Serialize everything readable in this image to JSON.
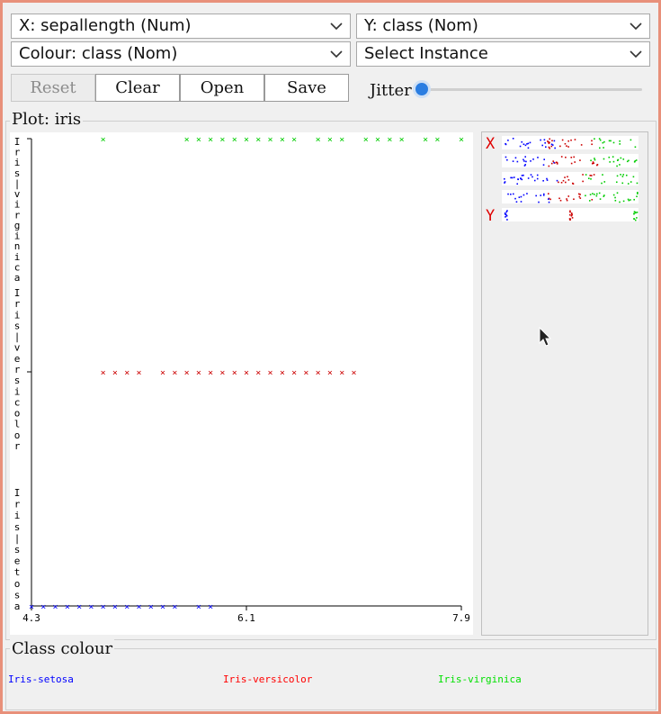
{
  "controls": {
    "x_axis": "X: sepallength (Num)",
    "y_axis": "Y: class (Nom)",
    "colour": "Colour: class (Nom)",
    "instance": "Select Instance"
  },
  "buttons": {
    "reset": "Reset",
    "clear": "Clear",
    "open": "Open",
    "save": "Save"
  },
  "jitter": {
    "label": "Jitter",
    "value": 0
  },
  "plot": {
    "title": "Plot: iris",
    "x_ticks": [
      "4.3",
      "6.1",
      "7.9"
    ],
    "y_labels": [
      "Iris-virginica",
      "Iris-versicolor",
      "Iris-setosa"
    ]
  },
  "matrix": {
    "x_marker": "X",
    "y_marker": "Y"
  },
  "class_colour": {
    "title": "Class colour",
    "items": [
      {
        "name": "Iris-setosa",
        "color": "#0000ff"
      },
      {
        "name": "Iris-versicolor",
        "color": "#ff0000"
      },
      {
        "name": "Iris-virginica",
        "color": "#00ff00"
      }
    ]
  },
  "colors": {
    "setosa": "#0000ff",
    "versicolor": "#cc0000",
    "virginica": "#00cc00",
    "border": "#e8907a"
  },
  "chart_data": {
    "type": "scatter",
    "xlabel": "sepallength",
    "ylabel": "class",
    "xlim": [
      4.3,
      7.9
    ],
    "categories": [
      "Iris-setosa",
      "Iris-versicolor",
      "Iris-virginica"
    ],
    "series": [
      {
        "name": "Iris-setosa",
        "category": "Iris-setosa",
        "x": [
          4.3,
          4.4,
          4.5,
          4.6,
          4.7,
          4.8,
          4.9,
          5.0,
          5.1,
          5.2,
          5.3,
          5.4,
          5.5,
          5.7,
          5.8
        ]
      },
      {
        "name": "Iris-versicolor",
        "category": "Iris-versicolor",
        "x": [
          4.9,
          5.0,
          5.1,
          5.2,
          5.4,
          5.5,
          5.6,
          5.7,
          5.8,
          5.9,
          6.0,
          6.1,
          6.2,
          6.3,
          6.4,
          6.5,
          6.6,
          6.7,
          6.8,
          6.9,
          7.0
        ]
      },
      {
        "name": "Iris-virginica",
        "category": "Iris-virginica",
        "x": [
          4.9,
          5.6,
          5.7,
          5.8,
          5.9,
          6.0,
          6.1,
          6.2,
          6.3,
          6.4,
          6.5,
          6.7,
          6.8,
          6.9,
          7.1,
          7.2,
          7.3,
          7.4,
          7.6,
          7.7,
          7.9
        ]
      }
    ]
  }
}
